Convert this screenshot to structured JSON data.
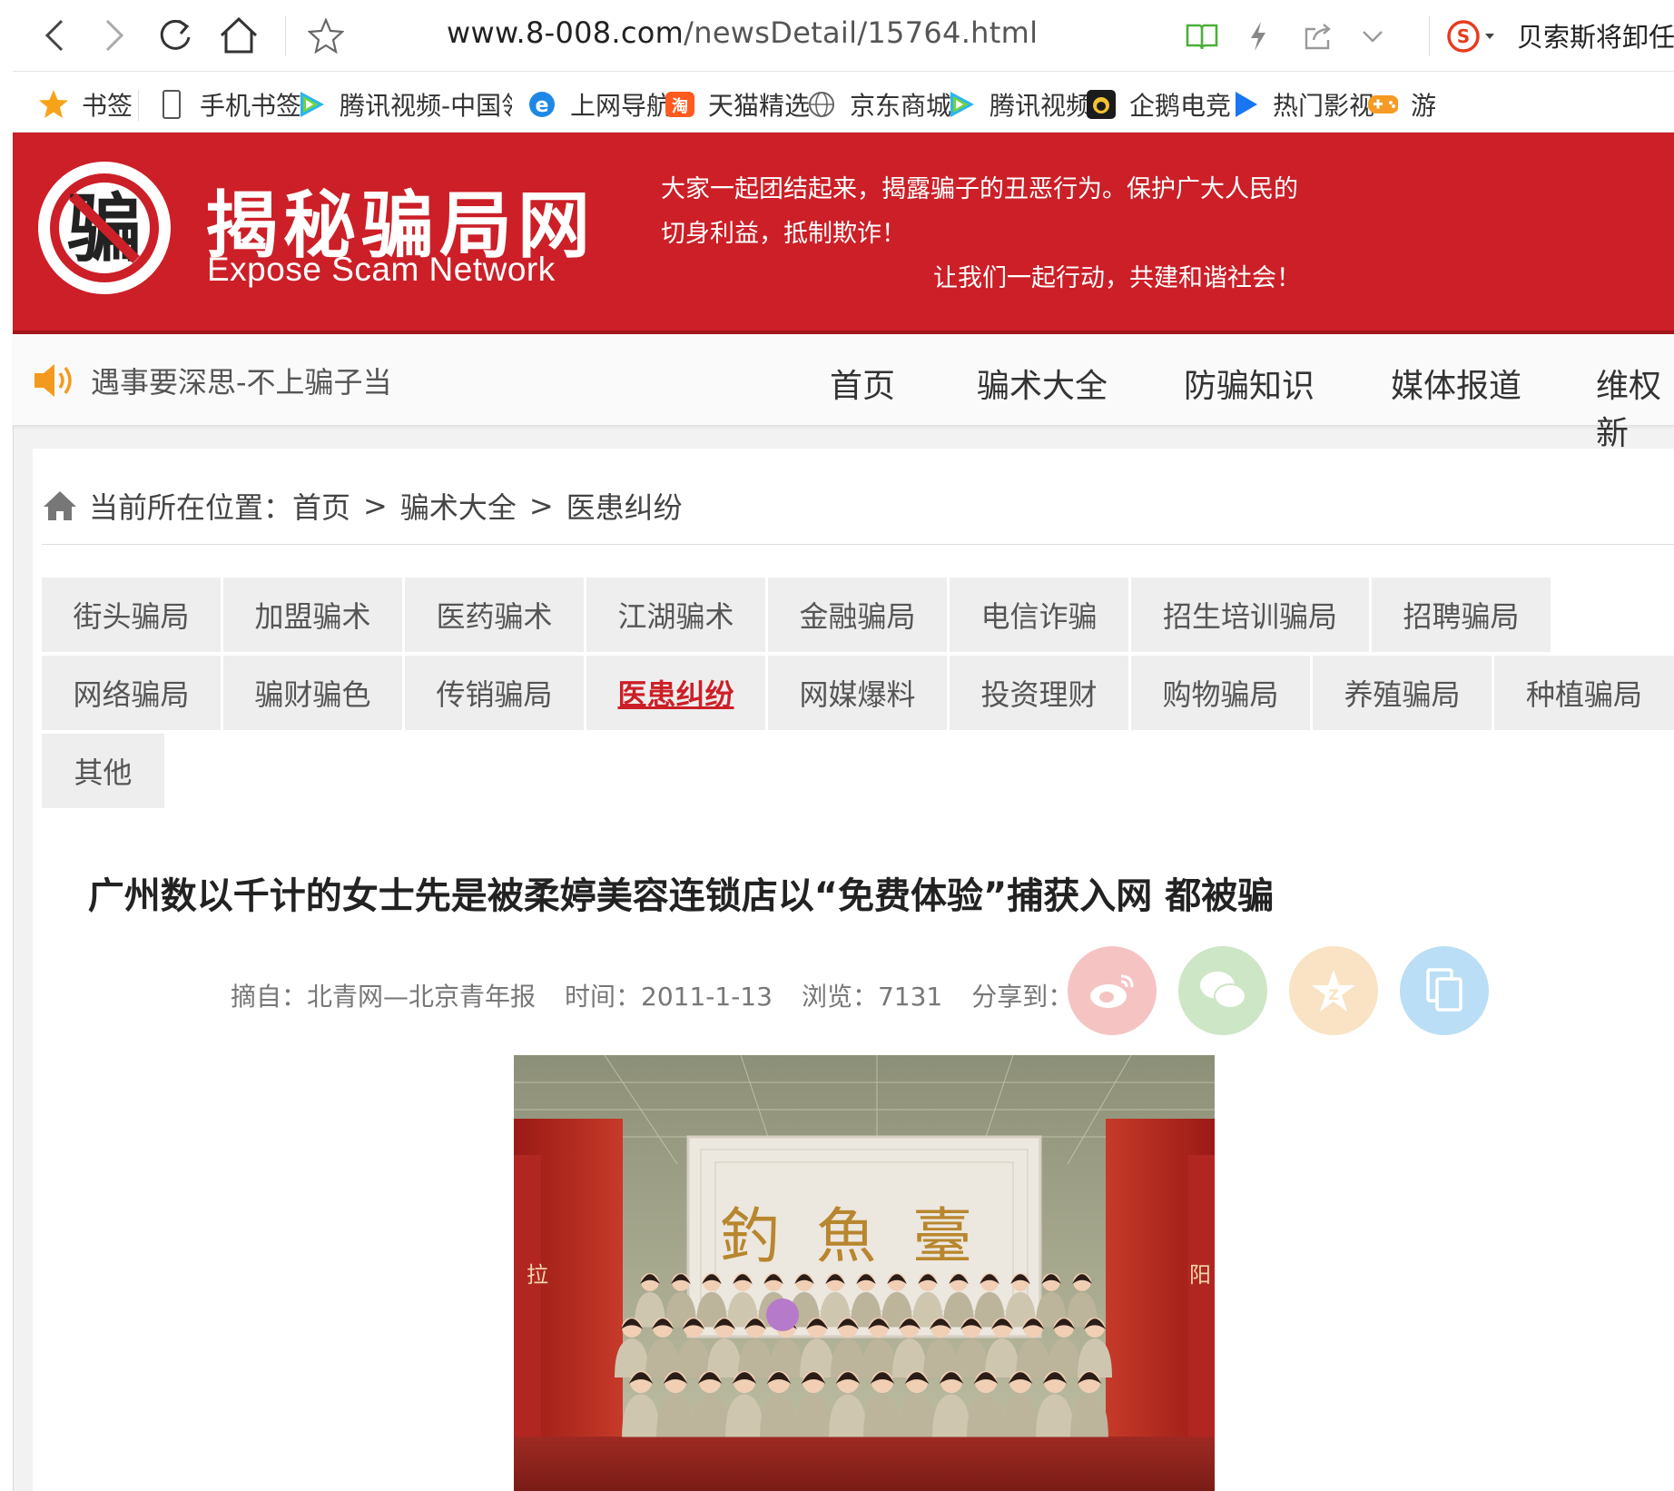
{
  "browser": {
    "url_host": "www.8-008.com",
    "url_path": "/newsDetail/15764.html",
    "search_text": "贝索斯将卸任C",
    "icons": [
      "back-icon",
      "forward-icon",
      "reload-icon",
      "home-icon",
      "star-icon",
      "reading-mode-icon",
      "bolt-icon",
      "share-icon",
      "chevron-down-icon",
      "sogou-icon"
    ]
  },
  "bookmarks": [
    {
      "label": "书签",
      "icon": "star-icon"
    },
    {
      "label": "手机书签",
      "icon": "phone-icon"
    },
    {
      "label": "腾讯视频-中国领先",
      "icon": "tencent-video-icon"
    },
    {
      "label": "上网导航",
      "icon": "ie-icon"
    },
    {
      "label": "天猫精选",
      "icon": "tmall-icon"
    },
    {
      "label": "京东商城",
      "icon": "globe-icon"
    },
    {
      "label": "腾讯视频",
      "icon": "tencent-video-icon"
    },
    {
      "label": "企鹅电竞",
      "icon": "penguin-icon"
    },
    {
      "label": "热门影视",
      "icon": "play-icon"
    },
    {
      "label": "游",
      "icon": "gamepad-icon"
    }
  ],
  "site": {
    "logo_char": "骗",
    "title": "揭秘骗局网",
    "subtitle": "Expose Scam Network",
    "slogan_line1": "大家一起团结起来，揭露骗子的丑恶行为。保护广大人民的",
    "slogan_line2": "切身利益，抵制欺诈！",
    "slogan_line3": "让我们一起行动，共建和谐社会！",
    "marquee": "遇事要深思-不上骗子当",
    "colors": {
      "brand_red": "#cc1f27",
      "active_red": "#cc1f27"
    }
  },
  "nav": [
    "首页",
    "骗术大全",
    "防骗知识",
    "媒体报道",
    "维权新"
  ],
  "breadcrumb": {
    "prefix": "当前所在位置：",
    "items": [
      "首页",
      "骗术大全",
      "医患纠纷"
    ],
    "separator": ">"
  },
  "categories": [
    "街头骗局",
    "加盟骗术",
    "医药骗术",
    "江湖骗术",
    "金融骗局",
    "电信诈骗",
    "招生培训骗局",
    "招聘骗局",
    "网络骗局",
    "骗财骗色",
    "传销骗局",
    "医患纠纷",
    "网媒爆料",
    "投资理财",
    "购物骗局",
    "养殖骗局",
    "种植骗局",
    "其他"
  ],
  "active_category": "医患纠纷",
  "article": {
    "title": "广州数以千计的女士先是被柔婷美容连锁店以“免费体验”捕获入网 都被骗",
    "source": "摘自：北青网—北京青年报",
    "time": "时间：2011-1-13",
    "views": "浏览：7131",
    "share_label": "分享到："
  },
  "share_buttons": [
    {
      "name": "weibo",
      "color": "#f6c3c3"
    },
    {
      "name": "wechat",
      "color": "#cde6c6"
    },
    {
      "name": "qzone",
      "color": "#f9e3c4"
    },
    {
      "name": "copy",
      "color": "#b9def5"
    }
  ],
  "photo": {
    "plaque_text": "釣魚臺",
    "side_left": "拉",
    "side_right": "阳"
  }
}
